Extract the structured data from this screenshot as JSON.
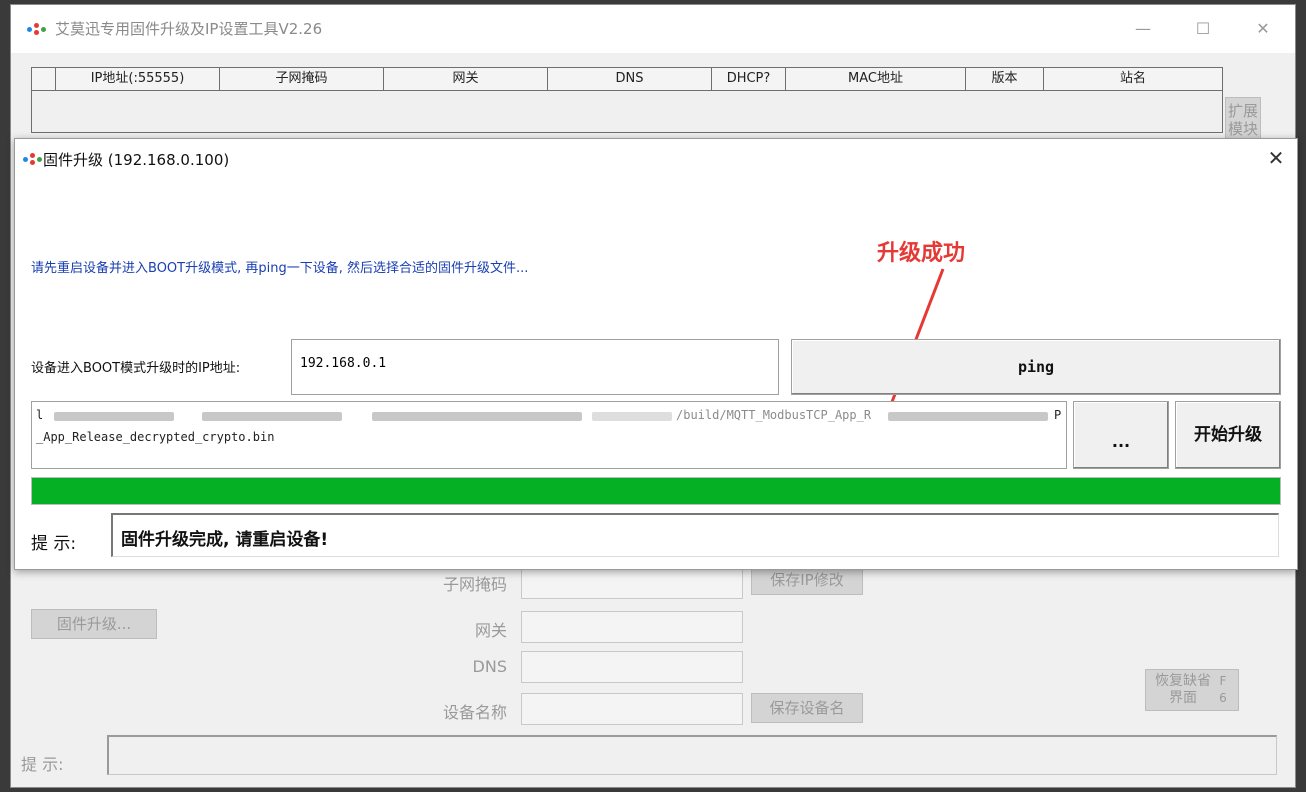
{
  "main_window": {
    "title": "艾莫迅专用固件升级及IP设置工具V2.26",
    "controls": {
      "minimize": "—",
      "maximize": "☐",
      "close": "✕"
    },
    "table_columns": [
      "",
      "IP地址(:55555)",
      "子网掩码",
      "网关",
      "DNS",
      "DHCP?",
      "MAC地址",
      "版本",
      "站名"
    ],
    "expand_button": "扩展模块",
    "labels": {
      "subnet": "子网掩码",
      "gateway": "网关",
      "dns": "DNS",
      "device_name": "设备名称"
    },
    "buttons": {
      "firmware_upgrade": "固件升级...",
      "save_ip": "保存IP修改",
      "save_name": "保存设备名",
      "restore_defaults": "恢复缺省界面",
      "restore_defaults_side": "F 6"
    },
    "hint_label": "提 示:",
    "hint_value": ""
  },
  "dialog": {
    "title": "固件升级 (192.168.0.100)",
    "close": "✕",
    "instruction": "请先重启设备并进入BOOT升级模式, 再ping一下设备, 然后选择合适的固件升级文件...",
    "ip_label": "设备进入BOOT模式升级时的IP地址:",
    "ip_value": "192.168.0.1",
    "ping_button": "ping",
    "file_path_line1_start": "l",
    "file_path_line1_mid": "/build/MQTT_ModbusTCP_App_R",
    "file_path_line1_end": "P",
    "file_path_line2": "_App_Release_decrypted_crypto.bin",
    "browse_button": "...",
    "start_button": "开始升级",
    "progress_percent": 100,
    "progress_color": "#06b025",
    "hint_label": "提 示:",
    "hint_value": "固件升级完成, 请重启设备!"
  },
  "annotation": {
    "text": "升级成功",
    "color": "#e53935"
  }
}
